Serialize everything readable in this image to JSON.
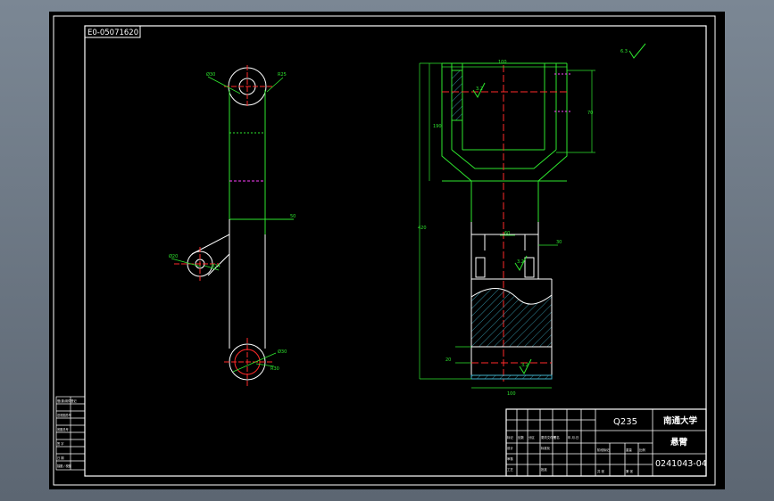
{
  "drawing": {
    "corner_code": "E0-05071620",
    "material": "Q235",
    "school": "南通大学",
    "part_name": "悬臂",
    "drawing_number": "0241043-04",
    "dim_top_width": "100",
    "dim_left_height": "190",
    "dim_right_height": "70",
    "dim_total_height": "420",
    "dim_bottom_width": "100",
    "dim_rod_a": "50",
    "dim_rod_b": "30",
    "dim_slot": "60",
    "dim_hole_top_a": "Ø30",
    "dim_hole_top_b": "R25",
    "dim_hole_mid_a": "Ø20",
    "dim_hole_mid_b": "R14",
    "dim_hole_bot_a": "Ø30",
    "dim_hole_bot_b": "R30",
    "roughness_a": "3.2",
    "roughness_b": "3.2",
    "roughness_c": "3.2",
    "general_roughness": "6.3",
    "dim_bottom_small": "20",
    "left_table": [
      "借(通)用件登记",
      "",
      "旧底图总号",
      "",
      "底图总号",
      "",
      "签 字",
      "",
      "日 期",
      "",
      "描图 / 校图"
    ],
    "title_block_labels": [
      "标记",
      "处数",
      "分区",
      "更改文件号",
      "签名",
      "年.月.日",
      "设计",
      "标准化",
      "审核",
      "工艺",
      "批准",
      "阶段标记",
      "重量",
      "比例",
      "共 张",
      "第 张"
    ]
  },
  "colors": {
    "background": "#000000",
    "outline": "#ffffff",
    "geometry": "#2ee62e",
    "centerline": "#ff2a2a",
    "hidden": "#ff40ff",
    "hatch": "#3fb0c8"
  }
}
